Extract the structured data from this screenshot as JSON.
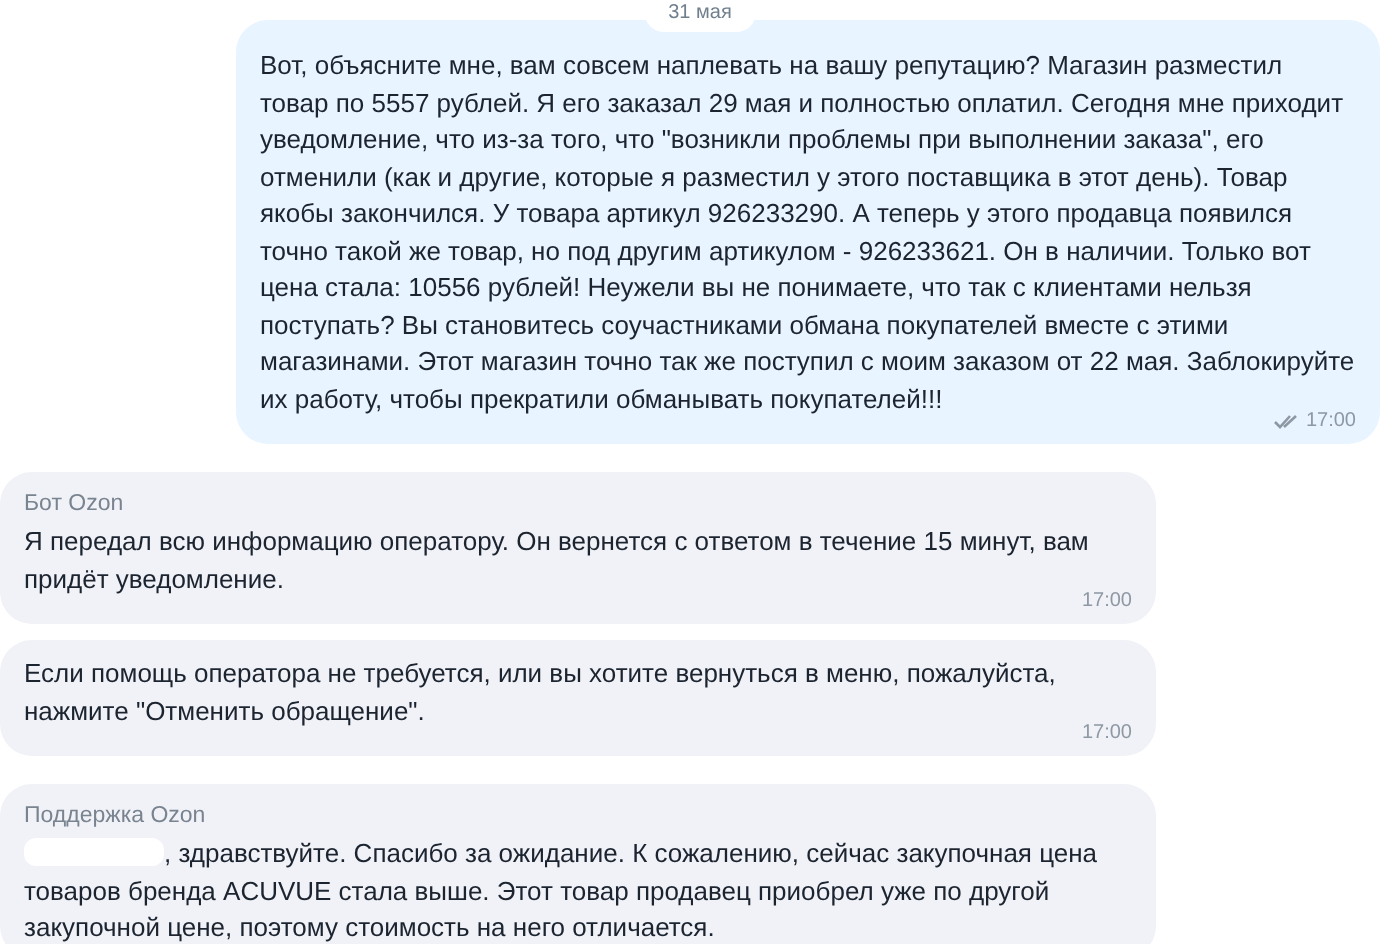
{
  "date_label": "31 мая",
  "messages": [
    {
      "kind": "outgoing",
      "text": "Вот, объясните мне, вам совсем наплевать на вашу репутацию? Магазин разместил товар по 5557 рублей. Я его заказал 29 мая и полностью оплатил. Сегодня мне приходит уведомление, что из-за того, что \"возникли проблемы при выполнении заказа\", его отменили (как и другие, которые я разместил у этого поставщика в этот день). Товар якобы закончился. У товара артикул 926233290. А теперь у этого продавца появился точно такой же товар, но под другим артикулом - 926233621. Он в наличии. Только вот цена стала: 10556 рублей! Неужели вы не понимаете, что так с клиентами нельзя поступать? Вы становитесь соучастниками обмана покупателей вместе с этими магазинами. Этот магазин точно так же поступил с моим заказом от 22 мая. Заблокируйте их работу, чтобы прекратили обманывать покупателей!!!",
      "time": "17:00",
      "read": true
    },
    {
      "kind": "incoming",
      "sender": "Бот Ozon",
      "text": "Я передал всю информацию оператору. Он вернется с ответом в течение 15 минут, вам придёт уведомление.",
      "time": "17:00"
    },
    {
      "kind": "incoming",
      "text": "Если помощь оператора не требуется, или вы хотите вернуться в меню, пожалуйста, нажмите \"Отменить обращение\".",
      "time": "17:00"
    },
    {
      "kind": "incoming",
      "sender": "Поддержка Ozon",
      "redacted": true,
      "text": ", здравствуйте. Спасибо за ожидание. К сожалению, сейчас закупочная цена товаров бренда ACUVUE стала выше. Этот товар продавец приобрел уже по другой закупочной цене, поэтому стоимость на него отличается."
    }
  ]
}
